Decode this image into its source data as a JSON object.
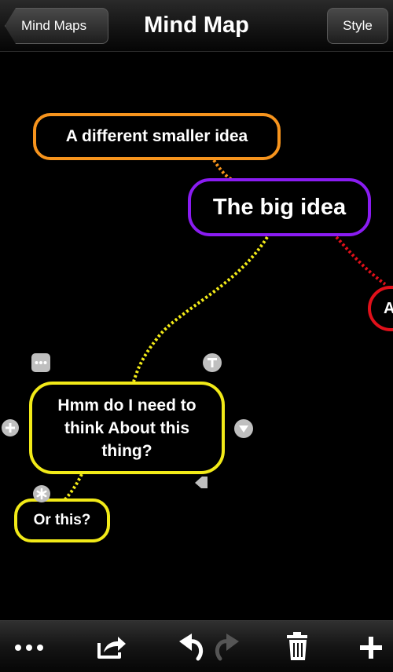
{
  "navbar": {
    "title": "Mind Map",
    "back_label": "Mind Maps",
    "style_label": "Style"
  },
  "nodes": {
    "orange": {
      "text": "A different smaller idea",
      "color": "#f7941d"
    },
    "purple": {
      "text": "The big idea",
      "color": "#8a1cf2"
    },
    "red": {
      "text": "A",
      "color": "#e0101a"
    },
    "yellow_main": {
      "text": "Hmm do I need to think About this thing?",
      "color": "#f2ea18"
    },
    "yellow_small": {
      "text": "Or this?",
      "color": "#f2ea18"
    }
  },
  "node_handles": [
    "more-icon",
    "text-icon",
    "add-icon",
    "collapse-icon",
    "resize-icon",
    "attachment-icon"
  ],
  "toolbar": {
    "items": [
      "more-icon",
      "share-icon",
      "undo-icon",
      "redo-icon",
      "trash-icon",
      "add-icon"
    ]
  },
  "colors": {
    "background": "#000000",
    "handle": "#bfbfbf"
  }
}
